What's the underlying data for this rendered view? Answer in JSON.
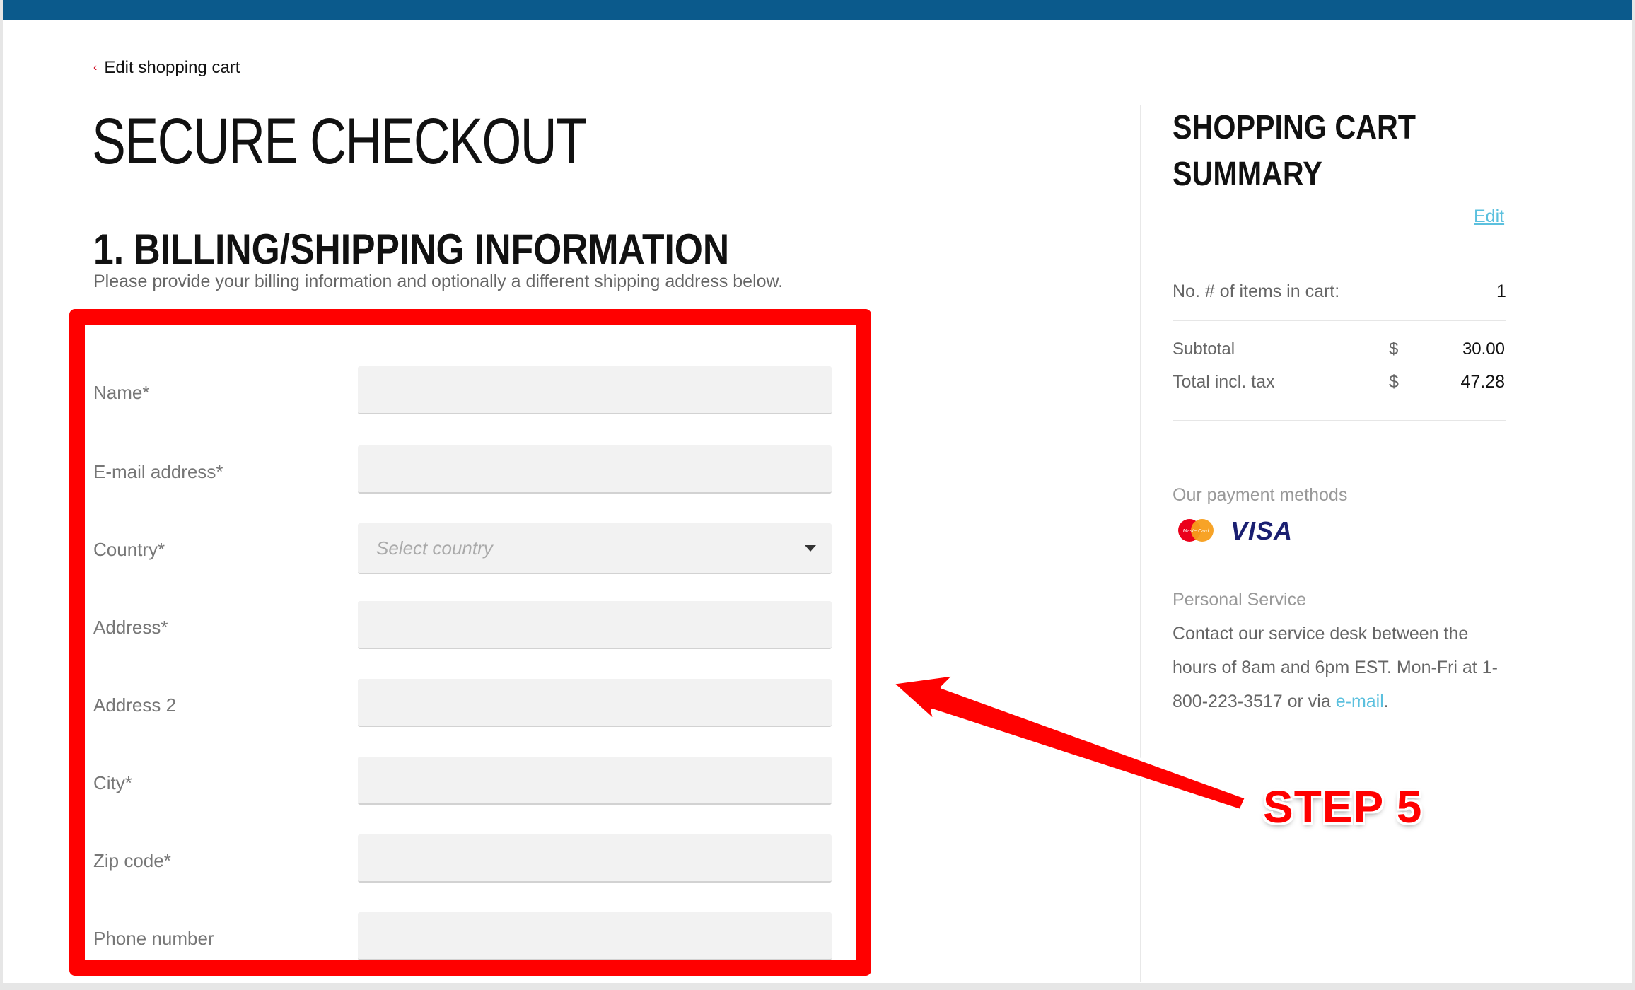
{
  "breadcrumb": {
    "label": "Edit shopping cart"
  },
  "page_title": "SECURE CHECKOUT",
  "section": {
    "title": "1. BILLING/SHIPPING INFORMATION",
    "subtitle": "Please provide your billing information and optionally a different shipping address below."
  },
  "form": {
    "fields": [
      {
        "label": "Name*",
        "value": ""
      },
      {
        "label": "E-mail address*",
        "value": ""
      },
      {
        "label": "Country*",
        "placeholder": "Select country"
      },
      {
        "label": "Address*",
        "value": ""
      },
      {
        "label": "Address 2",
        "value": ""
      },
      {
        "label": "City*",
        "value": ""
      },
      {
        "label": "Zip code*",
        "value": ""
      },
      {
        "label": "Phone number",
        "value": ""
      }
    ]
  },
  "summary": {
    "title": "SHOPPING CART SUMMARY",
    "edit_label": "Edit",
    "items_label": "No. # of items in cart:",
    "items_count": "1",
    "subtotal_label": "Subtotal",
    "subtotal_currency": "$",
    "subtotal_value": "30.00",
    "total_label": "Total incl. tax",
    "total_currency": "$",
    "total_value": "47.28"
  },
  "payment": {
    "title": "Our payment methods",
    "mastercard_text": "MasterCard",
    "visa_text": "VISA"
  },
  "service": {
    "title": "Personal Service",
    "text": "Contact our service desk between the hours of 8am and 6pm EST. Mon-Fri at 1-800-223-3517 or via ",
    "link": "e-mail",
    "end": "."
  },
  "annotation": {
    "step_label": "STEP 5",
    "color": "#ff0000"
  },
  "colors": {
    "topbar": "#0b5a8c",
    "link": "#5bc0de",
    "breadcrumb_chevron": "#d0021b"
  }
}
